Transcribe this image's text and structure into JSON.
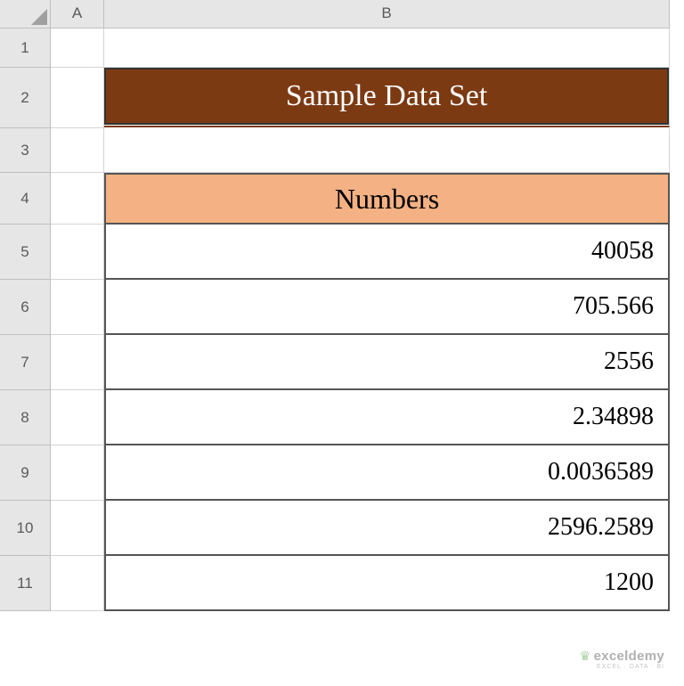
{
  "columns": {
    "A": "A",
    "B": "B"
  },
  "rows": [
    "1",
    "2",
    "3",
    "4",
    "5",
    "6",
    "7",
    "8",
    "9",
    "10",
    "11"
  ],
  "title": "Sample Data Set",
  "table_header": "Numbers",
  "chart_data": {
    "type": "table",
    "title": "Sample Data Set",
    "columns": [
      "Numbers"
    ],
    "values": [
      40058,
      705.566,
      2556,
      2.34898,
      0.0036589,
      2596.2589,
      1200
    ],
    "display": [
      "40058",
      "705.566",
      "2556",
      "2.34898",
      "0.0036589",
      "2596.2589",
      "1200"
    ]
  },
  "watermark": {
    "brand": "exceldemy",
    "tagline": "EXCEL · DATA · BI"
  }
}
